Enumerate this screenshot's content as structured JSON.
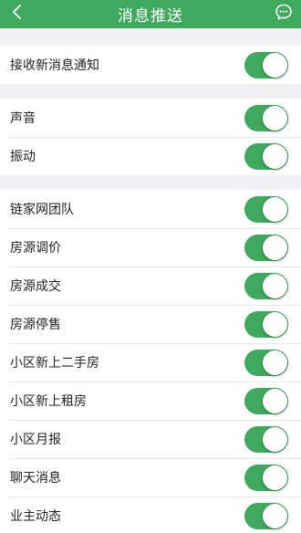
{
  "header": {
    "title": "消息推送",
    "back_icon": "chevron-left-icon",
    "message_icon": "chat-bubble-icon"
  },
  "colors": {
    "accent": "#3fa95e",
    "background": "#f0f0f2"
  },
  "groups": [
    {
      "items": [
        {
          "label": "接收新消息通知",
          "enabled": true
        }
      ]
    },
    {
      "items": [
        {
          "label": "声音",
          "enabled": true
        },
        {
          "label": "振动",
          "enabled": true
        }
      ]
    },
    {
      "items": [
        {
          "label": "链家网团队",
          "enabled": true
        },
        {
          "label": "房源调价",
          "enabled": true
        },
        {
          "label": "房源成交",
          "enabled": true
        },
        {
          "label": "房源停售",
          "enabled": true
        },
        {
          "label": "小区新上二手房",
          "enabled": true
        },
        {
          "label": "小区新上租房",
          "enabled": true
        },
        {
          "label": "小区月报",
          "enabled": true
        },
        {
          "label": "聊天消息",
          "enabled": true
        },
        {
          "label": "业主动态",
          "enabled": true
        }
      ]
    }
  ]
}
